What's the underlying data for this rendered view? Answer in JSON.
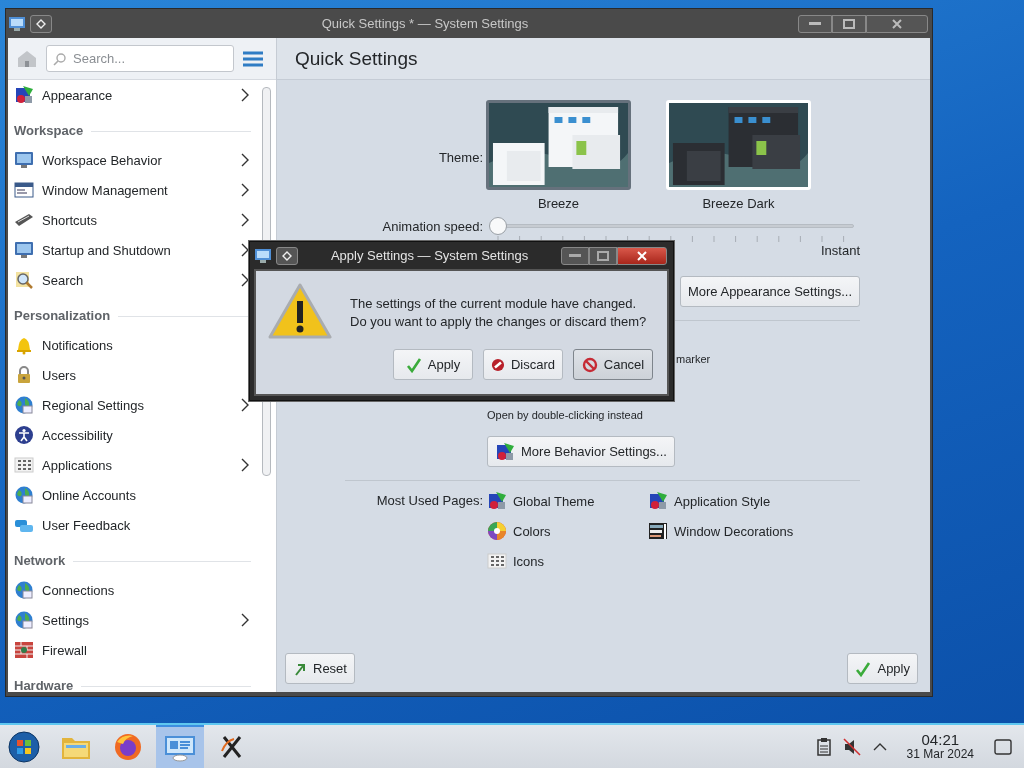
{
  "window": {
    "title": "Quick Settings * — System Settings"
  },
  "sidebar": {
    "search": {
      "placeholder": "Search..."
    },
    "items": [
      {
        "kind": "item",
        "label": "Appearance",
        "has_children": true
      },
      {
        "kind": "header",
        "label": "Workspace"
      },
      {
        "kind": "item",
        "label": "Workspace Behavior",
        "has_children": true
      },
      {
        "kind": "item",
        "label": "Window Management",
        "has_children": true
      },
      {
        "kind": "item",
        "label": "Shortcuts",
        "has_children": true
      },
      {
        "kind": "item",
        "label": "Startup and Shutdown",
        "has_children": true
      },
      {
        "kind": "item",
        "label": "Search",
        "has_children": true
      },
      {
        "kind": "header",
        "label": "Personalization"
      },
      {
        "kind": "item",
        "label": "Notifications",
        "has_children": false
      },
      {
        "kind": "item",
        "label": "Users",
        "has_children": false
      },
      {
        "kind": "item",
        "label": "Regional Settings",
        "has_children": true
      },
      {
        "kind": "item",
        "label": "Accessibility",
        "has_children": false
      },
      {
        "kind": "item",
        "label": "Applications",
        "has_children": true
      },
      {
        "kind": "item",
        "label": "Online Accounts",
        "has_children": false
      },
      {
        "kind": "item",
        "label": "User Feedback",
        "has_children": false
      },
      {
        "kind": "header",
        "label": "Network"
      },
      {
        "kind": "item",
        "label": "Connections",
        "has_children": false
      },
      {
        "kind": "item",
        "label": "Settings",
        "has_children": true
      },
      {
        "kind": "item",
        "label": "Firewall",
        "has_children": false
      },
      {
        "kind": "header",
        "label": "Hardware"
      }
    ]
  },
  "page": {
    "title": "Quick Settings",
    "theme": {
      "label": "Theme:",
      "options": [
        {
          "name": "Breeze",
          "selected": true
        },
        {
          "name": "Breeze Dark",
          "selected": false
        }
      ]
    },
    "animation_speed": {
      "label": "Animation speed:",
      "level": 0,
      "max_label": "Instant"
    },
    "more_appearance_button": "More Appearance Settings...",
    "partial_text": "marker",
    "open_hint": "Open by double-clicking instead",
    "more_behavior_button": "More Behavior Settings...",
    "most_used": {
      "label": "Most Used Pages:",
      "pages": [
        "Global Theme",
        "Application Style",
        "Colors",
        "Window Decorations",
        "Icons"
      ]
    },
    "reset_button": "Reset",
    "apply_button": "Apply"
  },
  "dialog": {
    "title": "Apply Settings — System Settings",
    "message": "The settings of the current module have changed.\nDo you want to apply the changes or discard them?",
    "buttons": [
      {
        "label": "Apply",
        "focused": false
      },
      {
        "label": "Discard",
        "focused": false
      },
      {
        "label": "Cancel",
        "focused": true
      }
    ]
  },
  "taskbar": {
    "tasks": [
      {
        "selected": false
      },
      {
        "selected": false
      },
      {
        "selected": true
      },
      {
        "selected": false
      }
    ],
    "clock": {
      "time": "04:21",
      "date": "31 Mar 2024"
    }
  }
}
